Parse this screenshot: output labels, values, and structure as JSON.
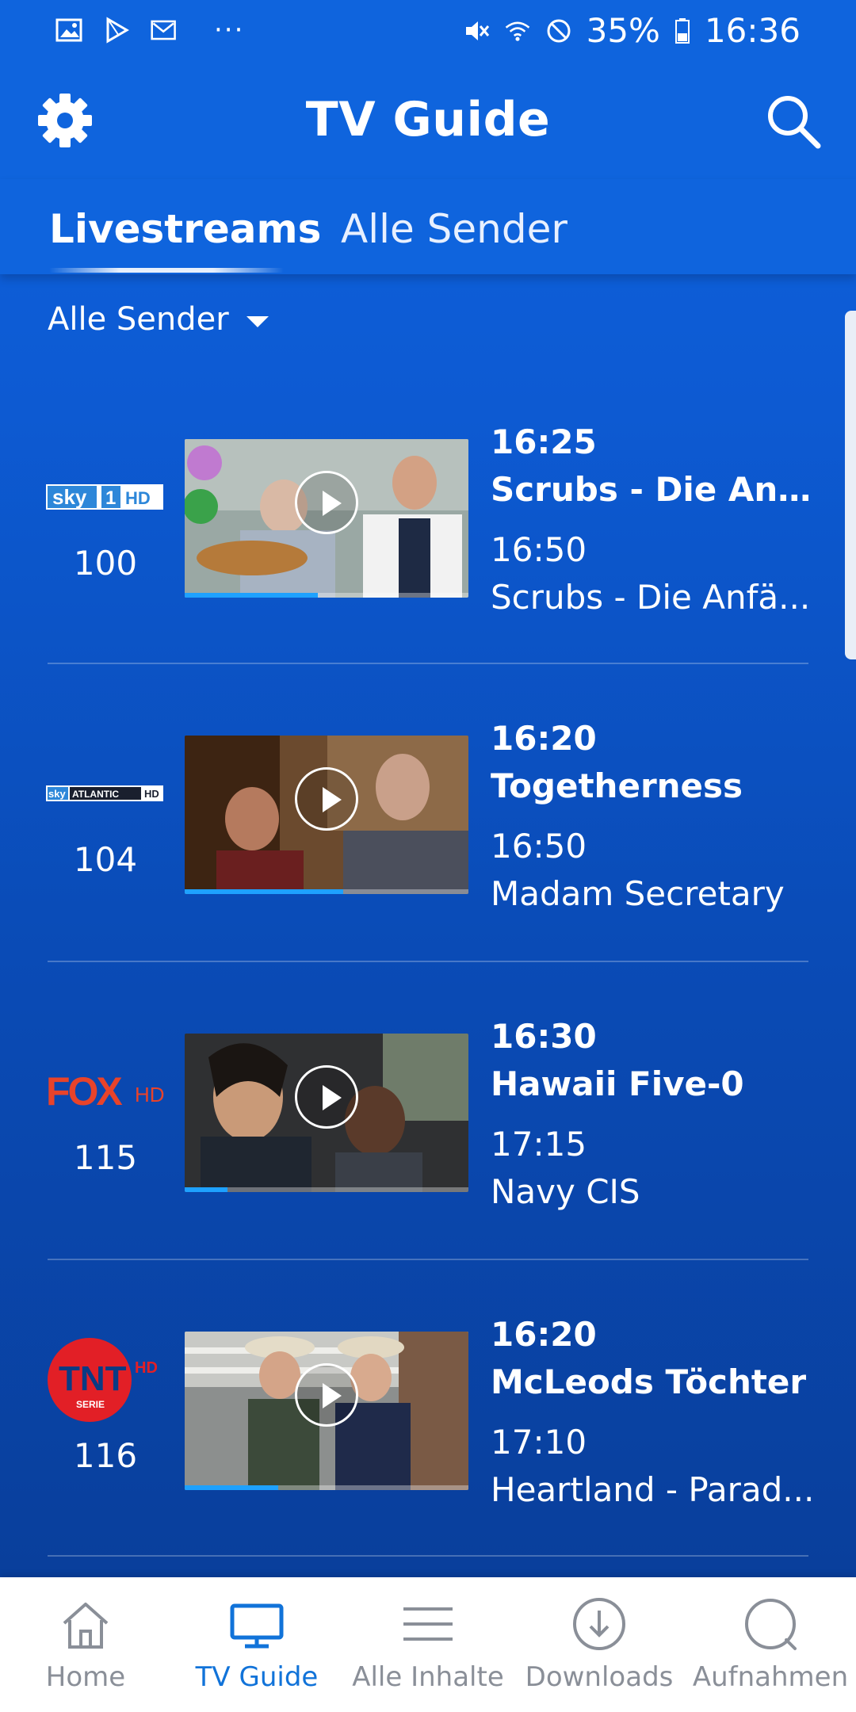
{
  "status_bar": {
    "battery": "35%",
    "time": "16:36",
    "more": "···"
  },
  "header": {
    "title": "TV Guide"
  },
  "tabs": [
    {
      "label": "Livestreams",
      "active": true
    },
    {
      "label": "Alle Sender",
      "active": false
    }
  ],
  "filter": {
    "label": "Alle Sender"
  },
  "channels": [
    {
      "logo": "sky 1 HD",
      "number": "100",
      "now_time": "16:25",
      "now_title": "Scrubs - Die Anfä...",
      "next_time": "16:50",
      "next_title": "Scrubs - Die Anfä...",
      "progress": 0.47
    },
    {
      "logo": "sky ATLANTIC HD",
      "number": "104",
      "now_time": "16:20",
      "now_title": "Togetherness",
      "next_time": "16:50",
      "next_title": "Madam Secretary",
      "progress": 0.56
    },
    {
      "logo": "FOX HD",
      "number": "115",
      "now_time": "16:30",
      "now_title": "Hawaii Five-0",
      "next_time": "17:15",
      "next_title": "Navy CIS",
      "progress": 0.15
    },
    {
      "logo": "TNT SERIE HD",
      "number": "116",
      "now_time": "16:20",
      "now_title": "McLeods Töchter",
      "next_time": "17:10",
      "next_title": "Heartland - Parad...",
      "progress": 0.33
    }
  ],
  "bottom_nav": [
    {
      "label": "Home",
      "icon": "home-icon",
      "active": false
    },
    {
      "label": "TV Guide",
      "icon": "tv-icon",
      "active": true
    },
    {
      "label": "Alle Inhalte",
      "icon": "menu-icon",
      "active": false
    },
    {
      "label": "Downloads",
      "icon": "download-icon",
      "active": false
    },
    {
      "label": "Aufnahmen",
      "icon": "record-icon",
      "active": false
    }
  ],
  "colors": {
    "header_blue": "#0f64dd",
    "progress_blue": "#1ea1ff",
    "active_nav": "#1173d9",
    "inactive_nav": "#8a8f98"
  }
}
